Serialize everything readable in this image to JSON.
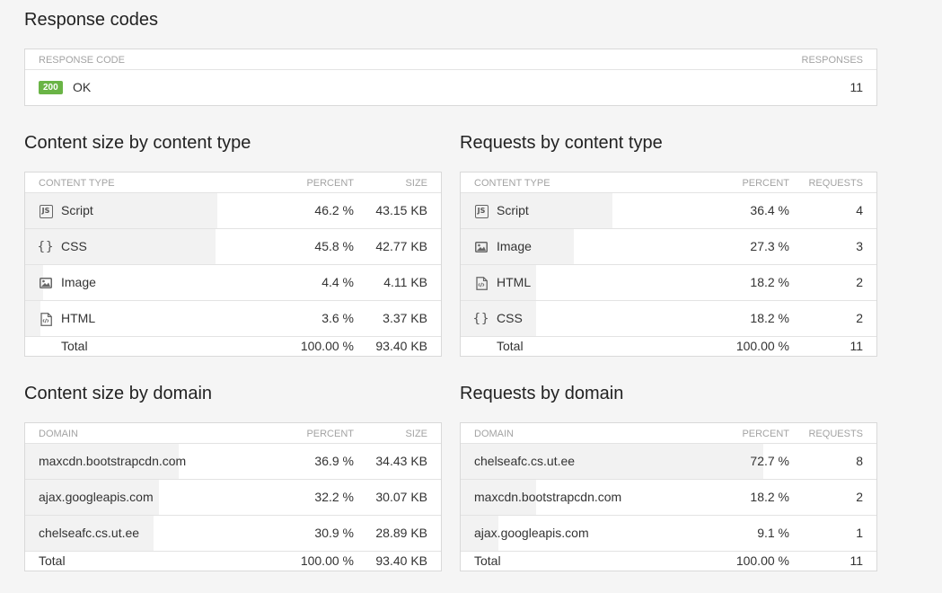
{
  "response_codes": {
    "title": "Response codes",
    "col_code": "Response code",
    "col_responses": "Responses",
    "rows": [
      {
        "code": "200",
        "label": "OK",
        "count": "11"
      }
    ]
  },
  "size_by_type": {
    "title": "Content size by content type",
    "col_type": "Content type",
    "col_percent": "Percent",
    "col_size": "Size",
    "rows": [
      {
        "icon": "js-file-icon",
        "name": "Script",
        "percent": "46.2 %",
        "size": "43.15 KB",
        "fraction": 0.462
      },
      {
        "icon": "css-braces-icon",
        "name": "CSS",
        "percent": "45.8 %",
        "size": "42.77 KB",
        "fraction": 0.458
      },
      {
        "icon": "image-icon",
        "name": "Image",
        "percent": "4.4 %",
        "size": "4.11 KB",
        "fraction": 0.044
      },
      {
        "icon": "html-file-icon",
        "name": "HTML",
        "percent": "3.6 %",
        "size": "3.37 KB",
        "fraction": 0.036
      }
    ],
    "total": {
      "label": "Total",
      "percent": "100.00 %",
      "size": "93.40 KB"
    }
  },
  "requests_by_type": {
    "title": "Requests by content type",
    "col_type": "Content type",
    "col_percent": "Percent",
    "col_requests": "Requests",
    "rows": [
      {
        "icon": "js-file-icon",
        "name": "Script",
        "percent": "36.4 %",
        "requests": "4",
        "fraction": 0.364
      },
      {
        "icon": "image-icon",
        "name": "Image",
        "percent": "27.3 %",
        "requests": "3",
        "fraction": 0.273
      },
      {
        "icon": "html-file-icon",
        "name": "HTML",
        "percent": "18.2 %",
        "requests": "2",
        "fraction": 0.182
      },
      {
        "icon": "css-braces-icon",
        "name": "CSS",
        "percent": "18.2 %",
        "requests": "2",
        "fraction": 0.182
      }
    ],
    "total": {
      "label": "Total",
      "percent": "100.00 %",
      "requests": "11"
    }
  },
  "size_by_domain": {
    "title": "Content size by domain",
    "col_domain": "Domain",
    "col_percent": "Percent",
    "col_size": "Size",
    "rows": [
      {
        "domain": "maxcdn.bootstrapcdn.com",
        "percent": "36.9 %",
        "size": "34.43 KB",
        "fraction": 0.369
      },
      {
        "domain": "ajax.googleapis.com",
        "percent": "32.2 %",
        "size": "30.07 KB",
        "fraction": 0.322
      },
      {
        "domain": "chelseafc.cs.ut.ee",
        "percent": "30.9 %",
        "size": "28.89 KB",
        "fraction": 0.309
      }
    ],
    "total": {
      "label": "Total",
      "percent": "100.00 %",
      "size": "93.40 KB"
    }
  },
  "requests_by_domain": {
    "title": "Requests by domain",
    "col_domain": "Domain",
    "col_percent": "Percent",
    "col_requests": "Requests",
    "rows": [
      {
        "domain": "chelseafc.cs.ut.ee",
        "percent": "72.7 %",
        "requests": "8",
        "fraction": 0.727
      },
      {
        "domain": "maxcdn.bootstrapcdn.com",
        "percent": "18.2 %",
        "requests": "2",
        "fraction": 0.182
      },
      {
        "domain": "ajax.googleapis.com",
        "percent": "9.1 %",
        "requests": "1",
        "fraction": 0.091
      }
    ],
    "total": {
      "label": "Total",
      "percent": "100.00 %",
      "requests": "11"
    }
  },
  "colors": {
    "badge_ok": "#6ab446",
    "bar_fill": "#f2f2f2"
  }
}
